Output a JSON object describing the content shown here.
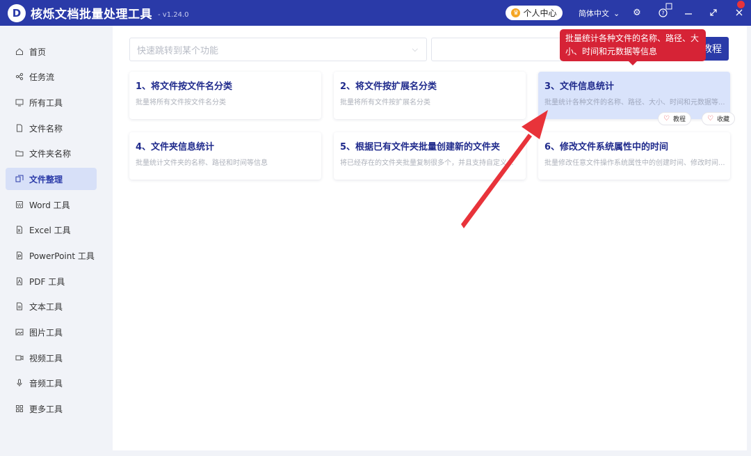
{
  "app": {
    "title": "核烁文档批量处理工具",
    "version": "- v1.24.0",
    "logo_letter": "D",
    "user_center": "个人中心",
    "language": "简体中文"
  },
  "sidebar": {
    "items": [
      {
        "label": "首页",
        "icon": "home-icon"
      },
      {
        "label": "任务流",
        "icon": "workflow-icon"
      },
      {
        "label": "所有工具",
        "icon": "monitor-icon"
      },
      {
        "label": "文件名称",
        "icon": "file-icon"
      },
      {
        "label": "文件夹名称",
        "icon": "folder-icon"
      },
      {
        "label": "文件整理",
        "icon": "organize-icon",
        "active": true
      },
      {
        "label": "Word 工具",
        "icon": "word-icon"
      },
      {
        "label": "Excel 工具",
        "icon": "excel-icon"
      },
      {
        "label": "PowerPoint 工具",
        "icon": "ppt-icon"
      },
      {
        "label": "PDF 工具",
        "icon": "pdf-icon"
      },
      {
        "label": "文本工具",
        "icon": "text-icon"
      },
      {
        "label": "图片工具",
        "icon": "image-icon"
      },
      {
        "label": "视频工具",
        "icon": "video-icon"
      },
      {
        "label": "音频工具",
        "icon": "audio-icon"
      },
      {
        "label": "更多工具",
        "icon": "grid-icon"
      }
    ]
  },
  "search": {
    "placeholder": "快速跳转到某个功能"
  },
  "tutorial_label": "教程",
  "tooltip": "批量统计各种文件的名称、路径、大小、时间和元数据等信息",
  "cards": [
    {
      "title": "1、将文件按文件名分类",
      "desc": "批量将所有文件按文件名分类"
    },
    {
      "title": "2、将文件按扩展名分类",
      "desc": "批量将所有文件按扩展名分类"
    },
    {
      "title": "3、文件信息统计",
      "desc": "批量统计各种文件的名称、路径、大小、时间和元数据等...",
      "active": true
    },
    {
      "title": "4、文件夹信息统计",
      "desc": "批量统计文件夹的名称、路径和时间等信息"
    },
    {
      "title": "5、根据已有文件夹批量创建新的文件夹",
      "desc": "将已经存在的文件夹批量复制很多个，并且支持自定义..."
    },
    {
      "title": "6、修改文件系统属性中的时间",
      "desc": "批量修改任意文件操作系统属性中的创建时间、修改时间..."
    }
  ],
  "card_actions": {
    "tutorial": "教程",
    "favorite": "收藏"
  },
  "colors": {
    "titlebar": "#2a3aa8",
    "accent": "#1f2a8c",
    "tooltip": "#d62336",
    "arrow": "#e8333a"
  }
}
